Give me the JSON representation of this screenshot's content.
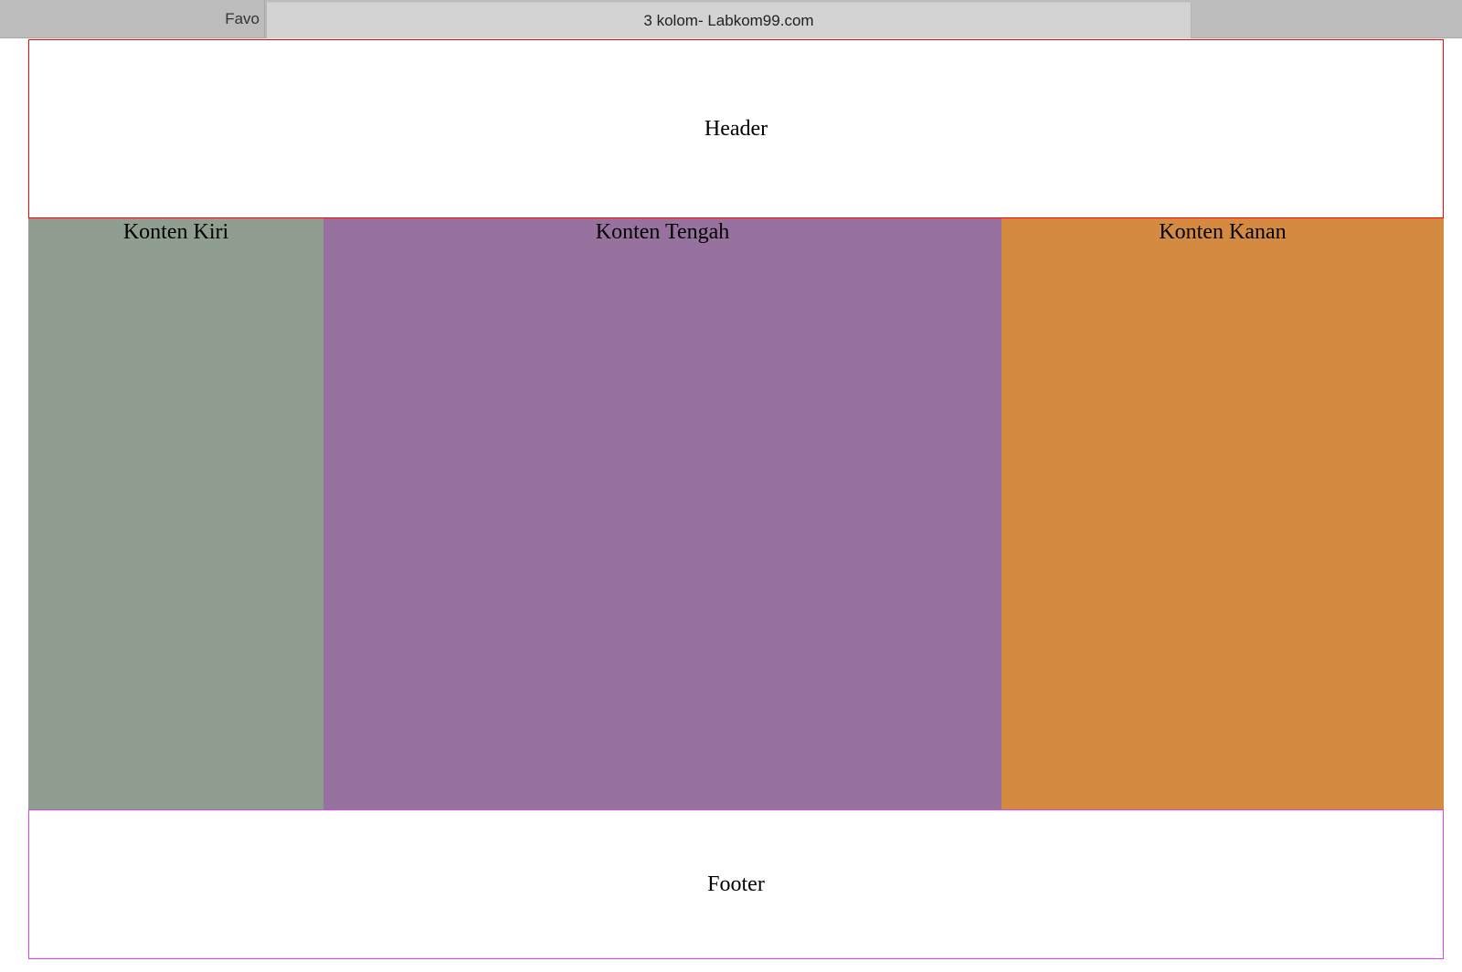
{
  "browser": {
    "tabs": [
      {
        "label": "Favo"
      },
      {
        "label": "3 kolom- Labkom99.com"
      }
    ]
  },
  "page": {
    "header": {
      "label": "Header"
    },
    "columns": [
      {
        "label": "Konten Kiri",
        "color": "#8f9e90"
      },
      {
        "label": "Konten Tengah",
        "color": "#97729e"
      },
      {
        "label": "Konten Kanan",
        "color": "#d48a40"
      }
    ],
    "footer": {
      "label": "Footer"
    }
  },
  "colors": {
    "header_border": "#ff0000",
    "footer_border": "#e040fb"
  }
}
